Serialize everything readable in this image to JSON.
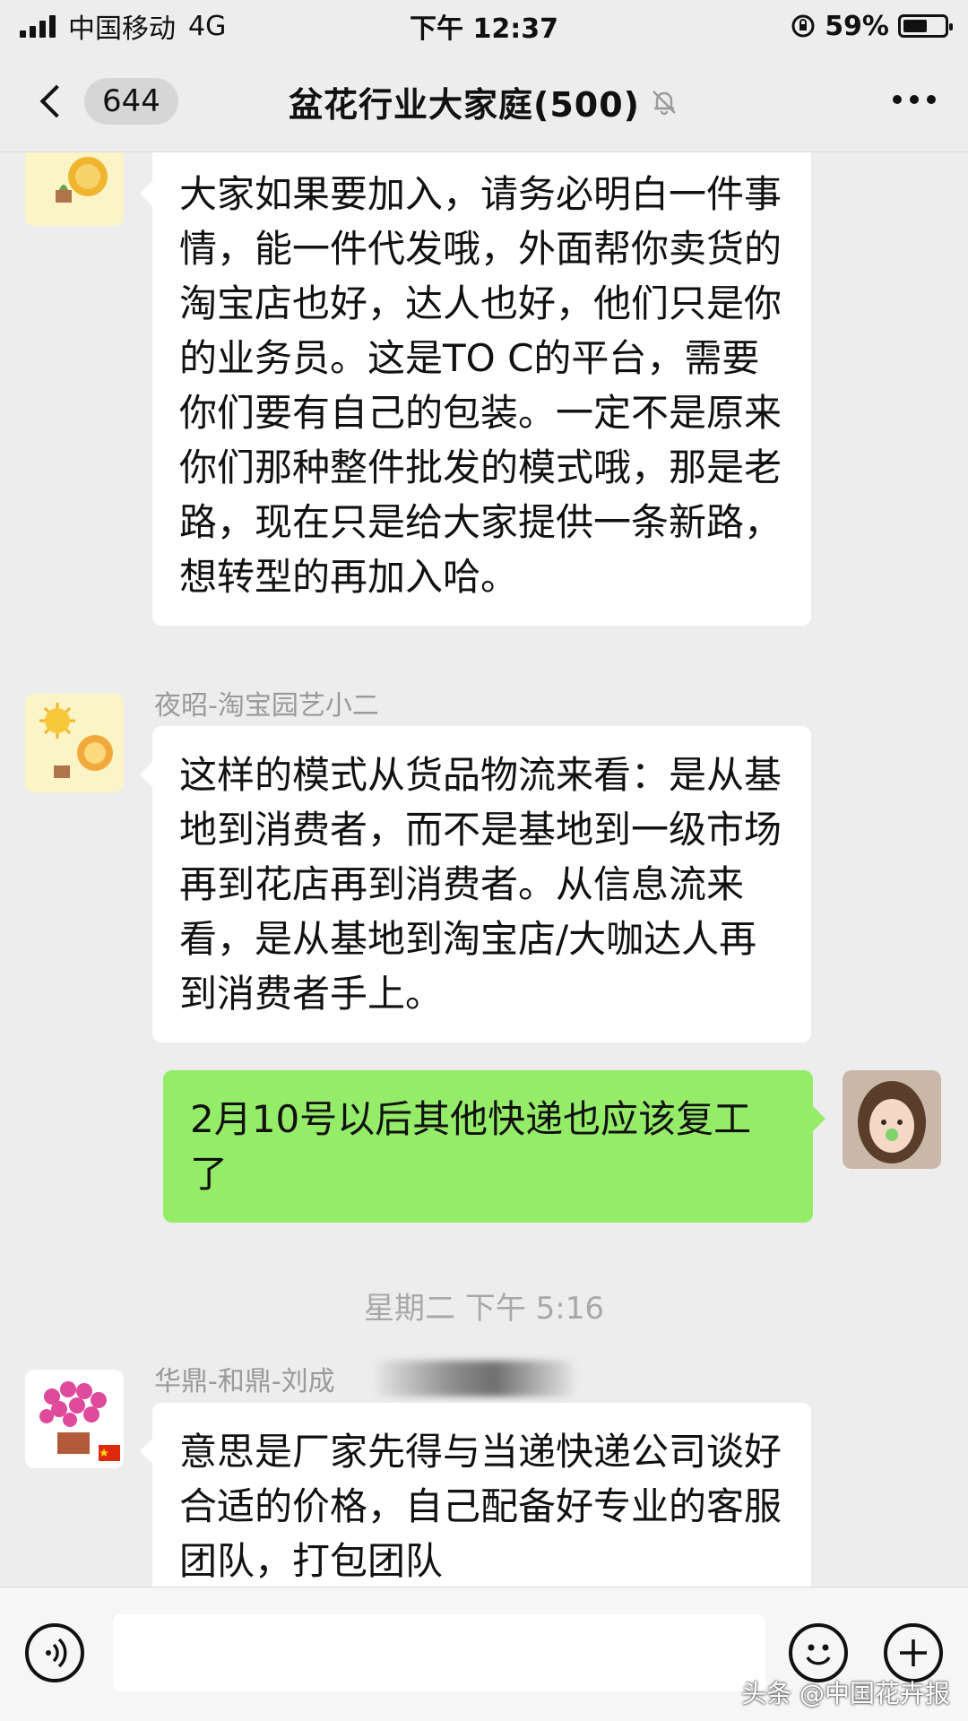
{
  "status_bar": {
    "carrier": "中国移动",
    "network": "4G",
    "time": "下午 12:37",
    "battery": "59%",
    "battery_level": 0.59
  },
  "nav": {
    "unread_count": "644",
    "title": "盆花行业大家庭(500)",
    "icons": [
      "chevron-left-icon",
      "bell-muted-icon",
      "more-dots-icon"
    ]
  },
  "messages": [
    {
      "side": "left",
      "sender": "",
      "avatar": "sun-lion-cartoon-avatar",
      "text": "大家如果要加入，请务必明白一件事情，能一件代发哦，外面帮你卖货的淘宝店也好，达人也好，他们只是你的业务员。这是TO C的平台，需要你们要有自己的包装。一定不是原来你们那种整件批发的模式哦，那是老路，现在只是给大家提供一条新路，想转型的再加入哈。"
    },
    {
      "side": "left",
      "sender": "夜昭-淘宝园艺小二",
      "avatar": "sun-lion-cartoon-avatar",
      "text": "这样的模式从货品物流来看：是从基地到消费者，而不是基地到一级市场再到花店再到消费者。从信息流来看，是从基地到淘宝店/大咖达人再到消费者手上。"
    },
    {
      "side": "right",
      "avatar": "girl-photo-avatar",
      "text": "2月10号以后其他快递也应该复工了"
    },
    {
      "side": "left",
      "sender": "华鼎-和鼎-刘成",
      "avatar": "potted-flower-avatar",
      "text": "意思是厂家先得与当递快递公司谈好合适的价格，自己配备好专业的客服团队，打包团队"
    }
  ],
  "timestamp": "星期二 下午 5:16",
  "input_bar": {
    "icons": [
      "voice-icon",
      "emoji-icon",
      "plus-icon"
    ]
  },
  "watermark": "头条 @中国花卉报",
  "colors": {
    "background": "#ededed",
    "bubble_incoming": "#ffffff",
    "bubble_outgoing": "#95ec69",
    "meta_text": "#9a9a9a"
  }
}
